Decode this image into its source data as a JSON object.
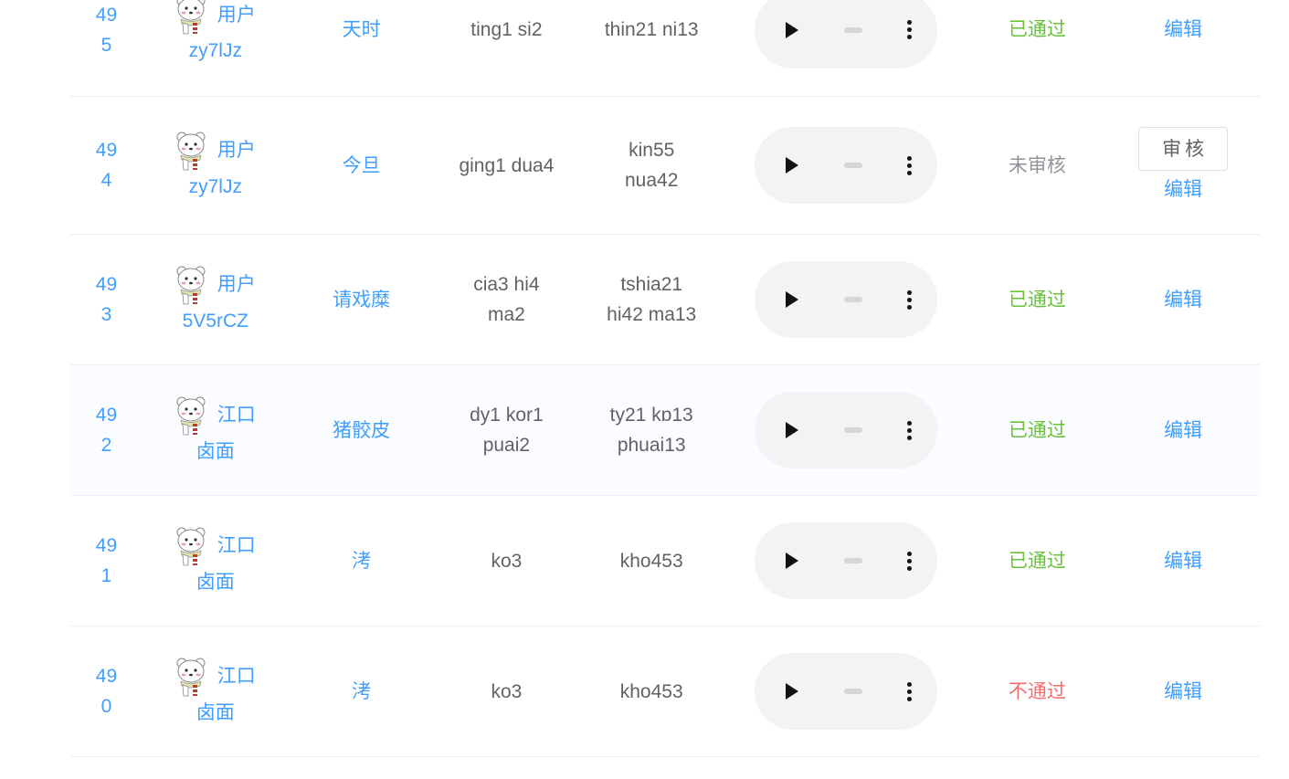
{
  "rows": [
    {
      "id": [
        "49",
        "5"
      ],
      "user_top": "用户",
      "user_sub": "zy7lJz",
      "word": "天时",
      "pinyin": [
        "ting1 si2"
      ],
      "tailo": [
        "thin21 ni13"
      ],
      "status": "已通过",
      "status_class": "pass",
      "audit_label": "",
      "edit_label": "编辑"
    },
    {
      "id": [
        "49",
        "4"
      ],
      "user_top": "用户",
      "user_sub": "zy7lJz",
      "word": "今旦",
      "pinyin": [
        "ging1 dua4"
      ],
      "tailo": [
        "kin55",
        "nua42"
      ],
      "status": "未审核",
      "status_class": "pending",
      "audit_label": "审核",
      "edit_label": "编辑"
    },
    {
      "id": [
        "49",
        "3"
      ],
      "user_top": "用户",
      "user_sub": "5V5rCZ",
      "word": "请戏糜",
      "pinyin": [
        "cia3 hi4",
        "ma2"
      ],
      "tailo": [
        "tshia21",
        "hi42 ma13"
      ],
      "status": "已通过",
      "status_class": "pass",
      "audit_label": "",
      "edit_label": "编辑"
    },
    {
      "id": [
        "49",
        "2"
      ],
      "user_top": "江口",
      "user_sub": "卤面",
      "word": "猪骹皮",
      "pinyin": [
        "dy1 kor1",
        "puai2"
      ],
      "tailo": [
        "ty21 kɒ13",
        "phuai13"
      ],
      "status": "已通过",
      "status_class": "pass",
      "audit_label": "",
      "edit_label": "编辑"
    },
    {
      "id": [
        "49",
        "1"
      ],
      "user_top": "江口",
      "user_sub": "卤面",
      "word": "洘",
      "pinyin": [
        "ko3"
      ],
      "tailo": [
        "kho453"
      ],
      "status": "已通过",
      "status_class": "pass",
      "audit_label": "",
      "edit_label": "编辑"
    },
    {
      "id": [
        "49",
        "0"
      ],
      "user_top": "江口",
      "user_sub": "卤面",
      "word": "洘",
      "pinyin": [
        "ko3"
      ],
      "tailo": [
        "kho453"
      ],
      "status": "不通过",
      "status_class": "fail",
      "audit_label": "",
      "edit_label": "编辑"
    }
  ],
  "icons": {
    "avatar": "bear-avatar-icon",
    "play": "play-icon",
    "menu": "more-vert-icon"
  },
  "colors": {
    "link": "#409eff",
    "pass": "#67c23a",
    "pending": "#909399",
    "fail": "#f56c6c",
    "player_bg": "#f1f3f4"
  }
}
